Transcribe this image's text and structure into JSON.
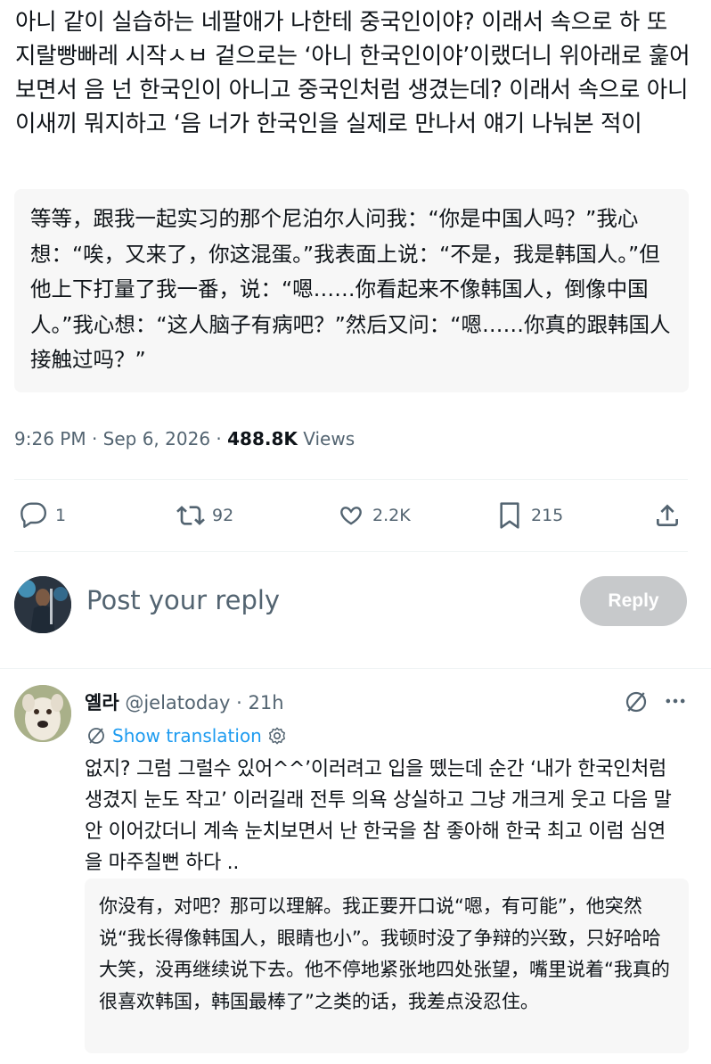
{
  "post": {
    "text": "아니 같이 실습하는 네팔애가 나한테 중국인이야? 이래서 속으로 하 또 지랄빵빠레 시작ㅅㅂ 겉으로는 ‘아니 한국인이야’이랬더니 위아래로 훑어보면서 음 넌 한국인이 아니고 중국인처럼 생겼는데? 이래서 속으로 아니 이새끼 뭐지하고 ‘음 너가 한국인을 실제로 만나서 얘기 나눠본 적이",
    "translation": "等等，跟我一起实习的那个尼泊尔人问我：“你是中国人吗？”我心想：“唉，又来了，你这混蛋。”我表面上说：“不是，我是韩国人。”但他上下打量了我一番，说：“嗯……你看起来不像韩国人，倒像中国人。”我心想：“这人脑子有病吧？”然后又问：“嗯……你真的跟韩国人接触过吗？”",
    "time": "9:26 PM · Sep 6, 2026 · ",
    "views_count": "488.8K",
    "views_label": " Views"
  },
  "actions": {
    "replies": "1",
    "reposts": "92",
    "likes": "2.2K",
    "bookmarks": "215"
  },
  "composer": {
    "placeholder": "Post your reply",
    "reply_button": "Reply"
  },
  "reply": {
    "name": "옐라",
    "handle": " @jelatoday · 21h",
    "show_translation": "Show translation",
    "text": "없지? 그럼 그럴수 있어^^’이러려고 입을 뗐는데 순간 ‘내가 한국인처럼 생겼지 눈도 작고’ 이러길래 전투 의욕 상실하고 그냥 개크게 웃고 다음 말 안 이어갔더니 계속 눈치보면서 난 한국을 참 좋아해 한국 최고 이럼 심연을 마주칠뻔 하다 ..",
    "translation": "你没有，对吧？那可以理解。我正要开口说“嗯，有可能”，他突然说“我长得像韩国人，眼睛也小”。我顿时没了争辩的兴致，只好哈哈大笑，没再继续说下去。他不停地紧张地四处张望，嘴里说着“我真的很喜欢韩国，韩国最棒了”之类的话，我差点没忍住。"
  },
  "colors": {
    "accent": "#1d9bf0",
    "muted": "#536471",
    "reply_button_disabled": "#c7c9cb"
  },
  "icons": [
    "reply-icon",
    "repost-icon",
    "like-icon",
    "bookmark-icon",
    "share-icon",
    "grok-icon",
    "more-icon",
    "translate-icon",
    "gear-icon"
  ]
}
